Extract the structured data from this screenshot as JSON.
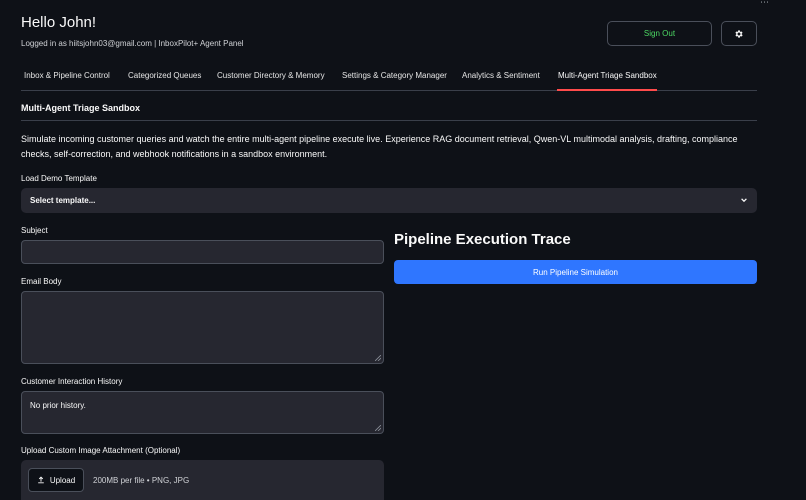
{
  "header": {
    "greeting": "Hello John!",
    "subline": "Logged in as hiitsjohn03@gmail.com | InboxPilot+ Agent Panel",
    "sign_out_label": "Sign Out",
    "settings_icon": "gear-icon"
  },
  "tabs": [
    {
      "label": "Inbox & Pipeline Control",
      "active": false
    },
    {
      "label": "Categorized Queues",
      "active": false
    },
    {
      "label": "Customer Directory & Memory",
      "active": false
    },
    {
      "label": "Settings & Category Manager",
      "active": false
    },
    {
      "label": "Analytics & Sentiment",
      "active": false
    },
    {
      "label": "Multi-Agent Triage Sandbox",
      "active": true
    }
  ],
  "section": {
    "title": "Multi-Agent Triage Sandbox",
    "description": "Simulate incoming customer queries and watch the entire multi-agent pipeline execute live. Experience RAG document retrieval, Qwen-VL multimodal analysis, drafting, compliance checks, self-correction, and webhook notifications in a sandbox environment."
  },
  "template": {
    "label": "Load Demo Template",
    "selected": "Select template..."
  },
  "form": {
    "subject_label": "Subject",
    "subject_value": "",
    "body_label": "Email Body",
    "body_value": "",
    "history_label": "Customer Interaction History",
    "history_value": "No prior history.",
    "upload_label": "Upload Custom Image Attachment (Optional)",
    "upload_button": "Upload",
    "upload_hint": "200MB per file • PNG, JPG"
  },
  "trace": {
    "title": "Pipeline Execution Trace",
    "run_label": "Run Pipeline Simulation"
  },
  "colors": {
    "background": "#0e1117",
    "accent_blue": "#2f76ff",
    "active_tab": "#ff4b4b",
    "sign_out": "#4cd964"
  }
}
